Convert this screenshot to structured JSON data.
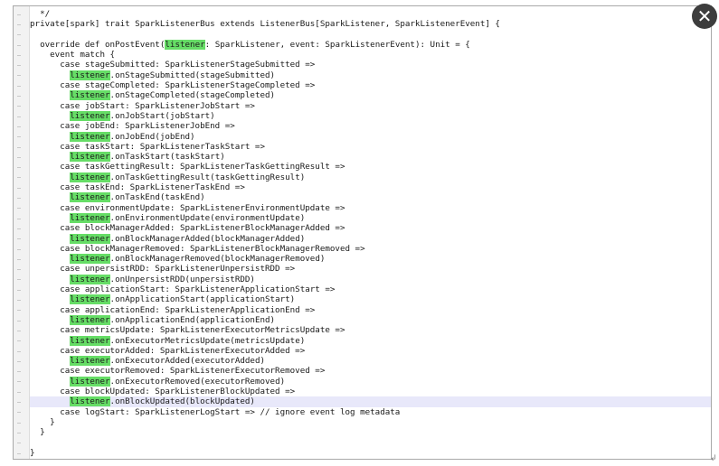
{
  "close_icon": "✕",
  "resize_icon": "↲",
  "highlight_color": "#66dd66",
  "current_line_color": "#e8e8fa",
  "lines": [
    {
      "indent": "  ",
      "parts": [
        {
          "t": "*/"
        }
      ]
    },
    {
      "indent": "",
      "parts": [
        {
          "t": "private[spark] trait SparkListenerBus extends ListenerBus[SparkListener, SparkListenerEvent] {"
        }
      ]
    },
    {
      "indent": "",
      "parts": [
        {
          "t": ""
        }
      ]
    },
    {
      "indent": "  ",
      "parts": [
        {
          "t": "override def onPostEvent("
        },
        {
          "t": "listener",
          "hl": true
        },
        {
          "t": ": SparkListener, event: SparkListenerEvent): Unit = {"
        }
      ]
    },
    {
      "indent": "    ",
      "parts": [
        {
          "t": "event match {"
        }
      ]
    },
    {
      "indent": "      ",
      "parts": [
        {
          "t": "case stageSubmitted: SparkListenerStageSubmitted =>"
        }
      ]
    },
    {
      "indent": "        ",
      "parts": [
        {
          "t": "listener",
          "hl": true
        },
        {
          "t": ".onStageSubmitted(stageSubmitted)"
        }
      ]
    },
    {
      "indent": "      ",
      "parts": [
        {
          "t": "case stageCompleted: SparkListenerStageCompleted =>"
        }
      ]
    },
    {
      "indent": "        ",
      "parts": [
        {
          "t": "listener",
          "hl": true
        },
        {
          "t": ".onStageCompleted(stageCompleted)"
        }
      ]
    },
    {
      "indent": "      ",
      "parts": [
        {
          "t": "case jobStart: SparkListenerJobStart =>"
        }
      ]
    },
    {
      "indent": "        ",
      "parts": [
        {
          "t": "listener",
          "hl": true
        },
        {
          "t": ".onJobStart(jobStart)"
        }
      ]
    },
    {
      "indent": "      ",
      "parts": [
        {
          "t": "case jobEnd: SparkListenerJobEnd =>"
        }
      ]
    },
    {
      "indent": "        ",
      "parts": [
        {
          "t": "listener",
          "hl": true
        },
        {
          "t": ".onJobEnd(jobEnd)"
        }
      ]
    },
    {
      "indent": "      ",
      "parts": [
        {
          "t": "case taskStart: SparkListenerTaskStart =>"
        }
      ]
    },
    {
      "indent": "        ",
      "parts": [
        {
          "t": "listener",
          "hl": true
        },
        {
          "t": ".onTaskStart(taskStart)"
        }
      ]
    },
    {
      "indent": "      ",
      "parts": [
        {
          "t": "case taskGettingResult: SparkListenerTaskGettingResult =>"
        }
      ]
    },
    {
      "indent": "        ",
      "parts": [
        {
          "t": "listener",
          "hl": true
        },
        {
          "t": ".onTaskGettingResult(taskGettingResult)"
        }
      ]
    },
    {
      "indent": "      ",
      "parts": [
        {
          "t": "case taskEnd: SparkListenerTaskEnd =>"
        }
      ]
    },
    {
      "indent": "        ",
      "parts": [
        {
          "t": "listener",
          "hl": true
        },
        {
          "t": ".onTaskEnd(taskEnd)"
        }
      ]
    },
    {
      "indent": "      ",
      "parts": [
        {
          "t": "case environmentUpdate: SparkListenerEnvironmentUpdate =>"
        }
      ]
    },
    {
      "indent": "        ",
      "parts": [
        {
          "t": "listener",
          "hl": true
        },
        {
          "t": ".onEnvironmentUpdate(environmentUpdate)"
        }
      ]
    },
    {
      "indent": "      ",
      "parts": [
        {
          "t": "case blockManagerAdded: SparkListenerBlockManagerAdded =>"
        }
      ]
    },
    {
      "indent": "        ",
      "parts": [
        {
          "t": "listener",
          "hl": true
        },
        {
          "t": ".onBlockManagerAdded(blockManagerAdded)"
        }
      ]
    },
    {
      "indent": "      ",
      "parts": [
        {
          "t": "case blockManagerRemoved: SparkListenerBlockManagerRemoved =>"
        }
      ]
    },
    {
      "indent": "        ",
      "parts": [
        {
          "t": "listener",
          "hl": true
        },
        {
          "t": ".onBlockManagerRemoved(blockManagerRemoved)"
        }
      ]
    },
    {
      "indent": "      ",
      "parts": [
        {
          "t": "case unpersistRDD: SparkListenerUnpersistRDD =>"
        }
      ]
    },
    {
      "indent": "        ",
      "parts": [
        {
          "t": "listener",
          "hl": true
        },
        {
          "t": ".onUnpersistRDD(unpersistRDD)"
        }
      ]
    },
    {
      "indent": "      ",
      "parts": [
        {
          "t": "case applicationStart: SparkListenerApplicationStart =>"
        }
      ]
    },
    {
      "indent": "        ",
      "parts": [
        {
          "t": "listener",
          "hl": true
        },
        {
          "t": ".onApplicationStart(applicationStart)"
        }
      ]
    },
    {
      "indent": "      ",
      "parts": [
        {
          "t": "case applicationEnd: SparkListenerApplicationEnd =>"
        }
      ]
    },
    {
      "indent": "        ",
      "parts": [
        {
          "t": "listener",
          "hl": true
        },
        {
          "t": ".onApplicationEnd(applicationEnd)"
        }
      ]
    },
    {
      "indent": "      ",
      "parts": [
        {
          "t": "case metricsUpdate: SparkListenerExecutorMetricsUpdate =>"
        }
      ]
    },
    {
      "indent": "        ",
      "parts": [
        {
          "t": "listener",
          "hl": true
        },
        {
          "t": ".onExecutorMetricsUpdate(metricsUpdate)"
        }
      ]
    },
    {
      "indent": "      ",
      "parts": [
        {
          "t": "case executorAdded: SparkListenerExecutorAdded =>"
        }
      ]
    },
    {
      "indent": "        ",
      "parts": [
        {
          "t": "listener",
          "hl": true
        },
        {
          "t": ".onExecutorAdded(executorAdded)"
        }
      ]
    },
    {
      "indent": "      ",
      "parts": [
        {
          "t": "case executorRemoved: SparkListenerExecutorRemoved =>"
        }
      ]
    },
    {
      "indent": "        ",
      "parts": [
        {
          "t": "listener",
          "hl": true
        },
        {
          "t": ".onExecutorRemoved(executorRemoved)"
        }
      ]
    },
    {
      "indent": "      ",
      "parts": [
        {
          "t": "case blockUpdated: SparkListenerBlockUpdated =>"
        }
      ]
    },
    {
      "indent": "        ",
      "current": true,
      "parts": [
        {
          "t": "listener",
          "hl": true
        },
        {
          "t": ".onBlockUpdated(blockUpdated)"
        }
      ]
    },
    {
      "indent": "      ",
      "parts": [
        {
          "t": "case logStart: SparkListenerLogStart => // ignore event log metadata"
        }
      ]
    },
    {
      "indent": "    ",
      "parts": [
        {
          "t": "}"
        }
      ]
    },
    {
      "indent": "  ",
      "parts": [
        {
          "t": "}"
        }
      ]
    },
    {
      "indent": "",
      "parts": [
        {
          "t": ""
        }
      ]
    },
    {
      "indent": "",
      "parts": [
        {
          "t": "}"
        }
      ]
    }
  ]
}
